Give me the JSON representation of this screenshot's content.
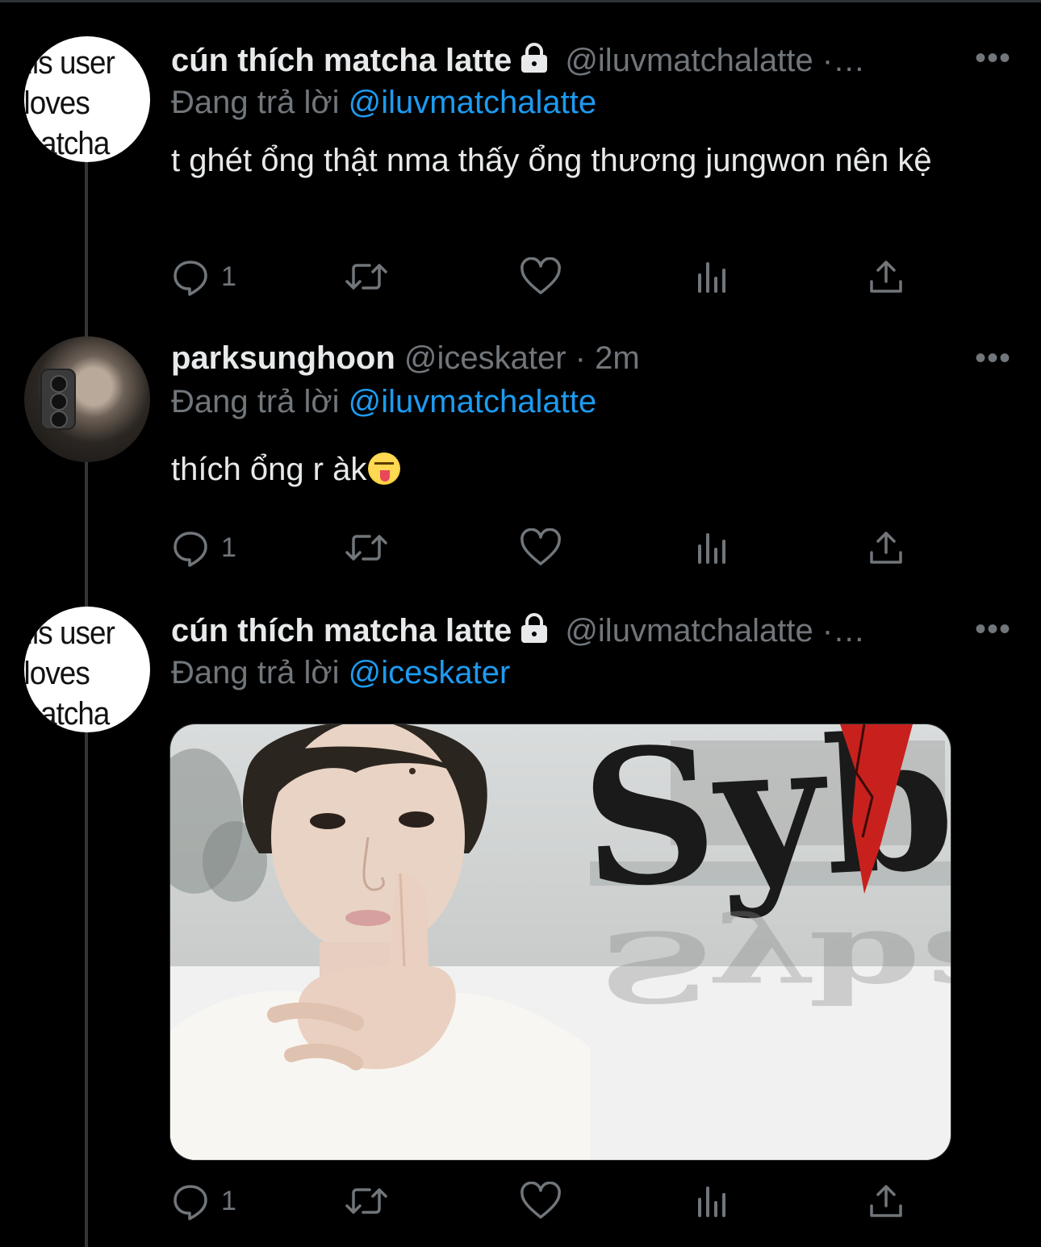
{
  "tweets": [
    {
      "avatar_text": [
        "this user",
        "loves",
        "matcha"
      ],
      "name": "cún thích matcha latte",
      "handle": "@iluvmatchalatte ·…",
      "replying_prefix": "Đang trả lời",
      "replying_to": "@iluvmatchalatte",
      "text": "t ghét ổng thật nma thấy ổng thương jungwon nên kệ",
      "reply_count": "1",
      "protected": true
    },
    {
      "name": "parksunghoon",
      "handle": "@iceskater · 2m",
      "replying_prefix": "Đang trả lời",
      "replying_to": "@iluvmatchalatte",
      "text": "thích ổng r àk",
      "emoji": "squinting-face-with-tongue",
      "reply_count": "1",
      "protected": false
    },
    {
      "avatar_text": [
        "this user",
        "loves",
        "matcha"
      ],
      "name": "cún thích matcha latte",
      "handle": "@iluvmatchalatte ·…",
      "replying_prefix": "Đang trả lời",
      "replying_to": "@iceskater",
      "media_text": "Sybau",
      "reply_count": "1",
      "protected": true
    }
  ],
  "icons": {
    "reply": "reply-icon",
    "retweet": "retweet-icon",
    "like": "heart-icon",
    "views": "views-icon",
    "share": "share-icon",
    "more": "more-icon",
    "lock": "lock-icon"
  },
  "colors": {
    "background": "#000000",
    "text": "#e7e9ea",
    "secondary": "#71767b",
    "accent": "#1d9bf0",
    "heart_in_media": "#c8211d"
  }
}
